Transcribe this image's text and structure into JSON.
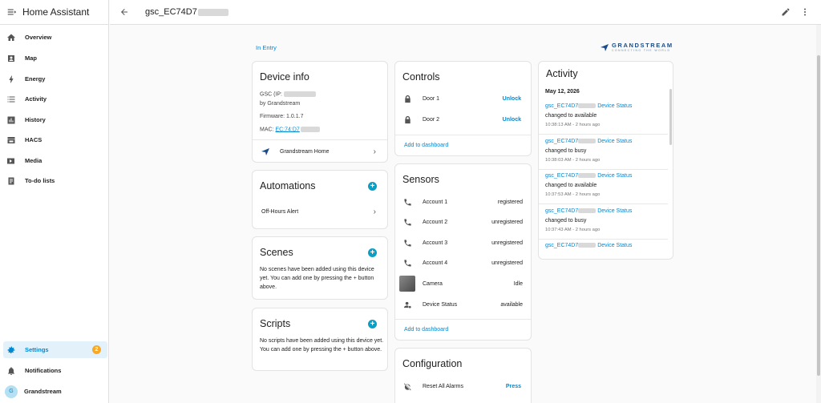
{
  "sidebar": {
    "title": "Home Assistant",
    "items": [
      {
        "label": "Overview",
        "icon": "home-icon"
      },
      {
        "label": "Map",
        "icon": "map-icon"
      },
      {
        "label": "Energy",
        "icon": "lightning-icon"
      },
      {
        "label": "Activity",
        "icon": "list-icon"
      },
      {
        "label": "History",
        "icon": "chart-icon"
      },
      {
        "label": "HACS",
        "icon": "hacs-icon"
      },
      {
        "label": "Media",
        "icon": "media-icon"
      },
      {
        "label": "To-do lists",
        "icon": "clipboard-icon"
      }
    ],
    "bottom": {
      "settings_label": "Settings",
      "settings_badge": "2",
      "notifications_label": "Notifications",
      "user_label": "Grandstream",
      "user_initial": "G"
    }
  },
  "header": {
    "title": "gsc_EC74D7",
    "edit_icon": "pencil-icon",
    "menu_icon": "dots-vertical-icon"
  },
  "breadcrumb": "In Entry",
  "brand": {
    "name": "GRANDSTREAM",
    "tagline": "CONNECTING THE WORLD",
    "color": "#1a4c8b"
  },
  "device_info": {
    "title": "Device info",
    "model": "GSC (IP:",
    "manufacturer": "by Grandstream",
    "firmware": "Firmware: 1.0.1.7",
    "mac_label": "MAC:",
    "mac_value": "EC:74:D7",
    "integration": "Grandstream Home"
  },
  "automations": {
    "title": "Automations",
    "items": [
      "Off-Hours Alert"
    ]
  },
  "scenes": {
    "title": "Scenes",
    "empty_text": "No scenes have been added using this device yet. You can add one by pressing the + button above."
  },
  "scripts": {
    "title": "Scripts",
    "empty_text": "No scripts have been added using this device yet. You can add one by pressing the + button above."
  },
  "controls": {
    "title": "Controls",
    "items": [
      {
        "label": "Door 1",
        "action": "Unlock",
        "icon": "lock-icon"
      },
      {
        "label": "Door 2",
        "action": "Unlock",
        "icon": "lock-icon"
      }
    ],
    "add_link": "Add to dashboard"
  },
  "sensors": {
    "title": "Sensors",
    "items": [
      {
        "label": "Account 1",
        "value": "registered",
        "icon": "phone-icon"
      },
      {
        "label": "Account 2",
        "value": "unregistered",
        "icon": "phone-icon"
      },
      {
        "label": "Account 3",
        "value": "unregistered",
        "icon": "phone-icon"
      },
      {
        "label": "Account 4",
        "value": "unregistered",
        "icon": "phone-icon"
      },
      {
        "label": "Camera",
        "value": "Idle",
        "icon": "camera-thumbnail"
      },
      {
        "label": "Device Status",
        "value": "available",
        "icon": "account-status-icon"
      }
    ],
    "add_link": "Add to dashboard"
  },
  "configuration": {
    "title": "Configuration",
    "items": [
      {
        "label": "Reset All Alarms",
        "action": "Press",
        "icon": "alarm-off-icon"
      }
    ]
  },
  "activity": {
    "title": "Activity",
    "date": "May 12, 2026",
    "entries": [
      {
        "name": "gsc_EC74D7",
        "suffix": " Device Status",
        "text": "changed to available",
        "time": "10:38:13 AM - 2 hours ago"
      },
      {
        "name": "gsc_EC74D7",
        "suffix": " Device Status",
        "text": "changed to busy",
        "time": "10:38:03 AM - 2 hours ago"
      },
      {
        "name": "gsc_EC74D7",
        "suffix": " Device Status",
        "text": "changed to available",
        "time": "10:37:53 AM - 2 hours ago"
      },
      {
        "name": "gsc_EC74D7",
        "suffix": " Device Status",
        "text": "changed to busy",
        "time": "10:37:43 AM - 2 hours ago"
      },
      {
        "name": "gsc_EC74D7",
        "suffix": " Device Status",
        "text": "",
        "time": ""
      }
    ]
  },
  "colors": {
    "accent": "#0288d1",
    "badge": "#f9a825",
    "plus": "#0aa0c6"
  }
}
